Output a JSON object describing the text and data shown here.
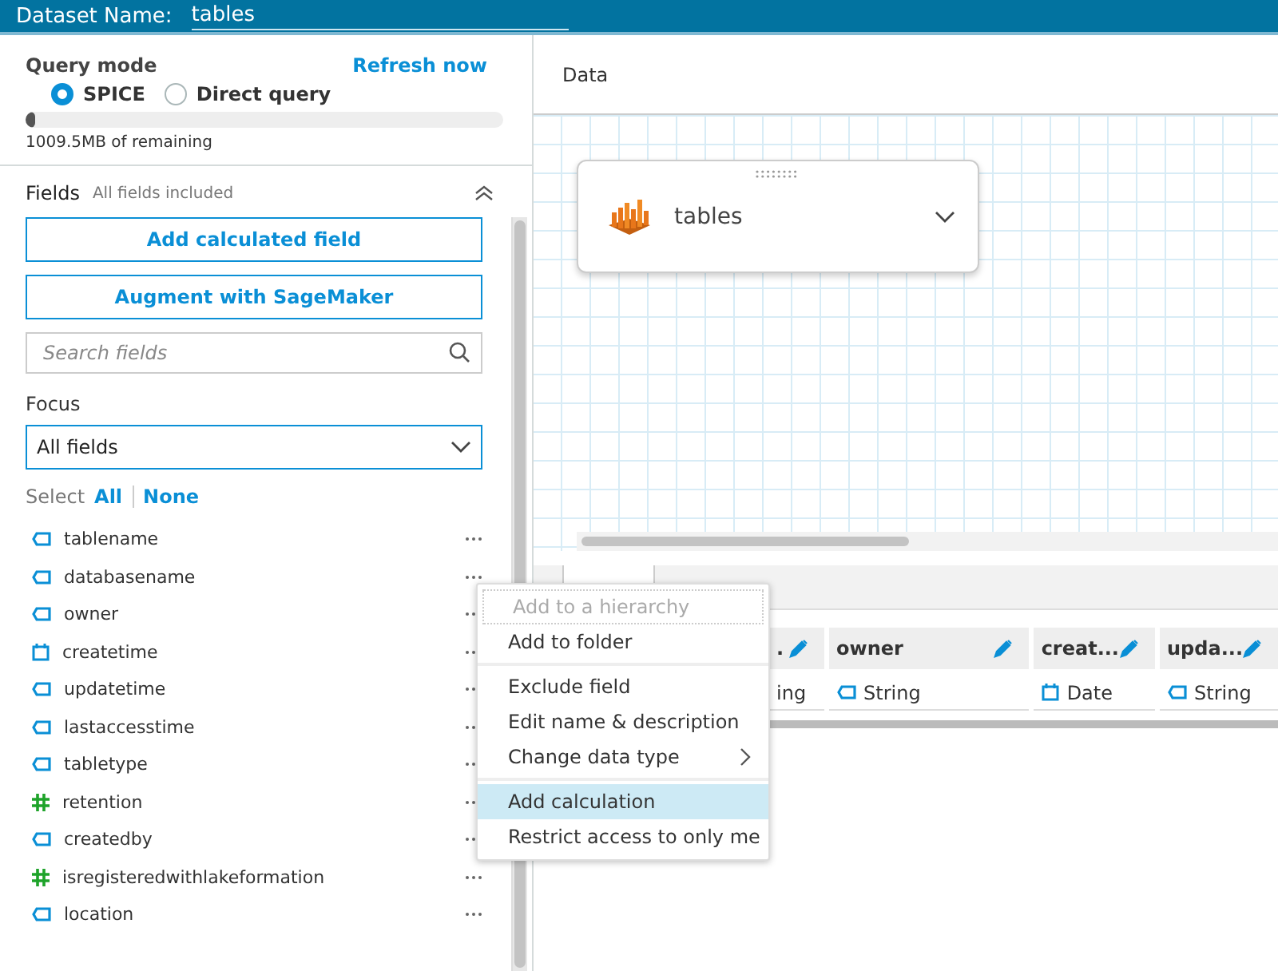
{
  "header": {
    "label": "Dataset Name:",
    "value": "tables"
  },
  "query_mode": {
    "title": "Query mode",
    "refresh": "Refresh now",
    "options": [
      {
        "label": "SPICE",
        "selected": true
      },
      {
        "label": "Direct query",
        "selected": false
      }
    ],
    "usage": {
      "level": 0.02
    },
    "remaining": "1009.5MB of remaining"
  },
  "fields": {
    "title": "Fields",
    "subtitle": "All fields included",
    "buttons": [
      "Add calculated field",
      "Augment with SageMaker"
    ],
    "search": {
      "placeholder": "Search fields"
    },
    "focus_label": "Focus",
    "focus_value": "All fields",
    "select_label": "Select",
    "select_all": "All",
    "select_none": "None",
    "items": [
      {
        "name": "tablename",
        "kind": "string"
      },
      {
        "name": "databasename",
        "kind": "string"
      },
      {
        "name": "owner",
        "kind": "string"
      },
      {
        "name": "createtime",
        "kind": "date"
      },
      {
        "name": "updatetime",
        "kind": "string"
      },
      {
        "name": "lastaccesstime",
        "kind": "string"
      },
      {
        "name": "tabletype",
        "kind": "string"
      },
      {
        "name": "retention",
        "kind": "number"
      },
      {
        "name": "createdby",
        "kind": "string"
      },
      {
        "name": "isregisteredwithlakeformation",
        "kind": "number"
      },
      {
        "name": "location",
        "kind": "string"
      }
    ]
  },
  "data": {
    "title": "Data",
    "source": {
      "name": "tables"
    },
    "columns": [
      {
        "name": ".",
        "type": "ing",
        "kind": "partial"
      },
      {
        "name": "owner",
        "type": "String",
        "kind": "string"
      },
      {
        "name": "creat...",
        "type": "Date",
        "kind": "date"
      },
      {
        "name": "upda...",
        "type": "String",
        "kind": "string"
      }
    ]
  },
  "context_menu": {
    "items": [
      {
        "label": "Add to a hierarchy",
        "disabled": true,
        "selected": false
      },
      {
        "label": "Add to folder",
        "disabled": false,
        "selected": false
      },
      {
        "kind": "divider"
      },
      {
        "label": "Exclude field",
        "disabled": false,
        "selected": false
      },
      {
        "label": "Edit name & description",
        "disabled": false,
        "selected": false
      },
      {
        "label": "Change data type",
        "disabled": false,
        "selected": false,
        "submenu": true
      },
      {
        "kind": "divider"
      },
      {
        "label": "Add calculation",
        "disabled": false,
        "selected": true
      },
      {
        "label": "Restrict access to only me",
        "disabled": false,
        "selected": false
      }
    ]
  }
}
